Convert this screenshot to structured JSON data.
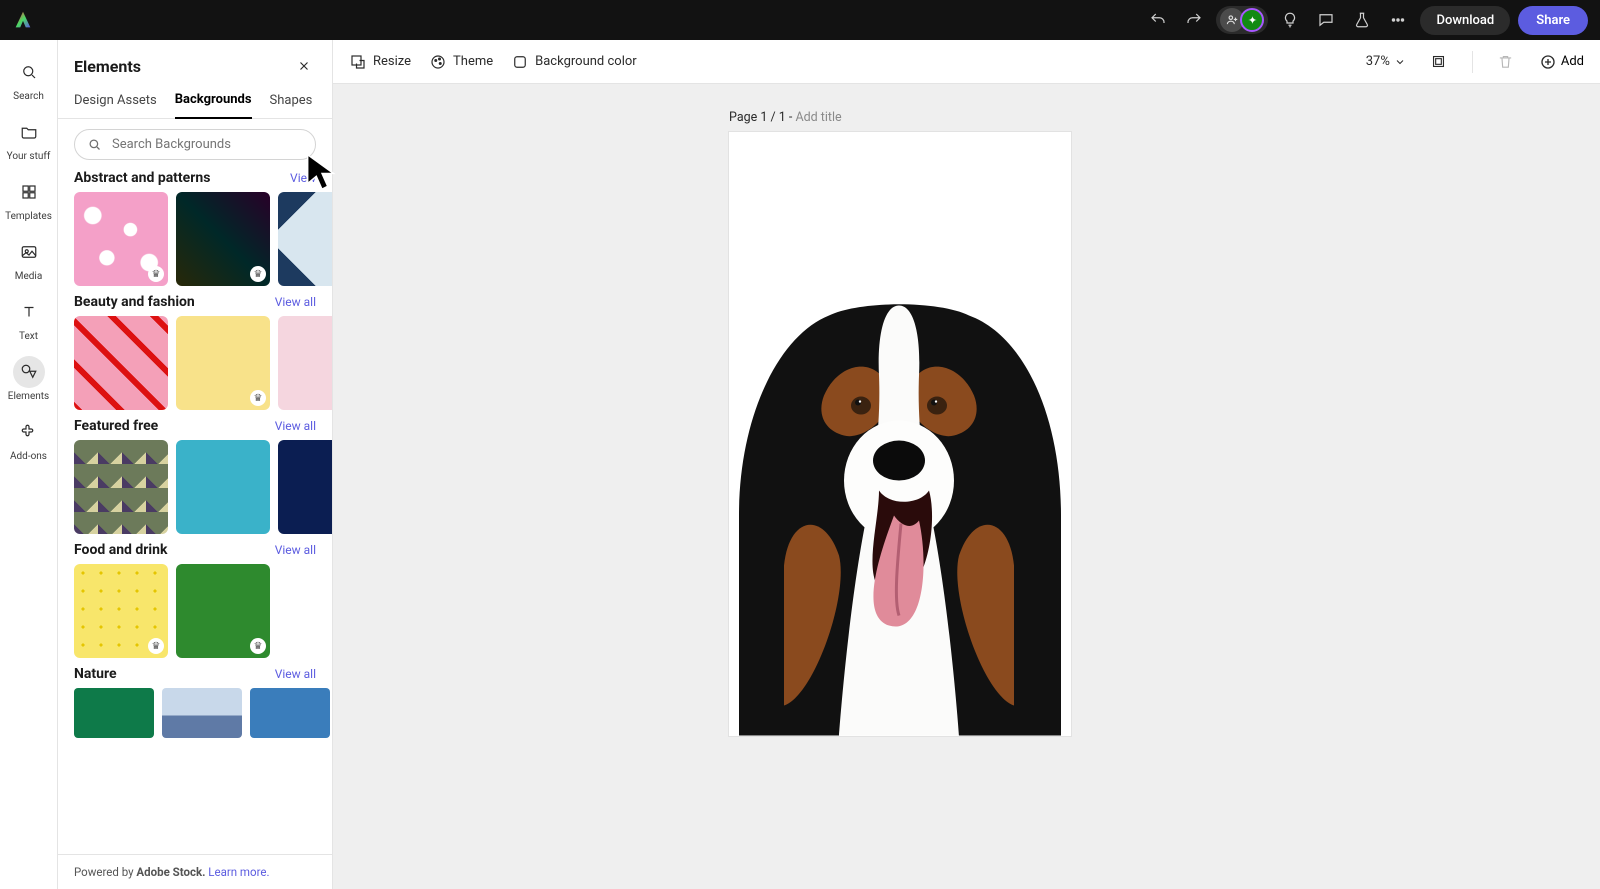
{
  "topbar": {
    "download": "Download",
    "share": "Share"
  },
  "rail": {
    "search": "Search",
    "your_stuff": "Your stuff",
    "templates": "Templates",
    "media": "Media",
    "text": "Text",
    "elements": "Elements",
    "addons": "Add-ons"
  },
  "panel": {
    "title": "Elements",
    "tabs": {
      "design_assets": "Design Assets",
      "backgrounds": "Backgrounds",
      "shapes": "Shapes"
    },
    "search_placeholder": "Search Backgrounds",
    "sections": {
      "abstract": {
        "title": "Abstract and patterns",
        "viewall": "View"
      },
      "beauty": {
        "title": "Beauty and fashion",
        "viewall": "View all"
      },
      "featured": {
        "title": "Featured free",
        "viewall": "View all"
      },
      "food": {
        "title": "Food and drink",
        "viewall": "View all"
      },
      "nature": {
        "title": "Nature",
        "viewall": "View all"
      }
    },
    "footer": {
      "prefix": "Powered by ",
      "brand": "Adobe Stock.",
      "learn": "Learn more."
    }
  },
  "canvas_toolbar": {
    "resize": "Resize",
    "theme": "Theme",
    "bgcolor": "Background color",
    "zoom": "37%",
    "add": "Add"
  },
  "canvas": {
    "page_prefix": "Page 1 / 1 - ",
    "add_title": "Add title"
  }
}
